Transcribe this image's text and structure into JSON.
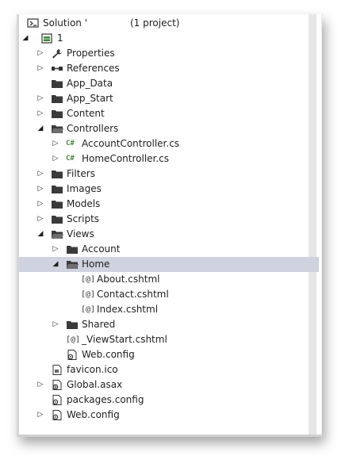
{
  "solution": {
    "label": "Solution '",
    "suffix": "(1 project)"
  },
  "project": {
    "label": "1"
  },
  "tree": [
    {
      "label": "Properties",
      "icon": "wrench-icon",
      "arrow": "collapsed"
    },
    {
      "label": "References",
      "icon": "references-icon",
      "arrow": "collapsed"
    },
    {
      "label": "App_Data",
      "icon": "folder-icon",
      "arrow": "none"
    },
    {
      "label": "App_Start",
      "icon": "folder-icon",
      "arrow": "collapsed"
    },
    {
      "label": "Content",
      "icon": "folder-icon",
      "arrow": "collapsed"
    },
    {
      "label": "Controllers",
      "icon": "folder-open-icon",
      "arrow": "expanded"
    },
    {
      "label": "AccountController.cs",
      "icon": "csharp-file-icon",
      "arrow": "collapsed"
    },
    {
      "label": "HomeController.cs",
      "icon": "csharp-file-icon",
      "arrow": "collapsed"
    },
    {
      "label": "Filters",
      "icon": "folder-icon",
      "arrow": "collapsed"
    },
    {
      "label": "Images",
      "icon": "folder-icon",
      "arrow": "collapsed"
    },
    {
      "label": "Models",
      "icon": "folder-icon",
      "arrow": "collapsed"
    },
    {
      "label": "Scripts",
      "icon": "folder-icon",
      "arrow": "collapsed"
    },
    {
      "label": "Views",
      "icon": "folder-open-icon",
      "arrow": "expanded"
    },
    {
      "label": "Account",
      "icon": "folder-icon",
      "arrow": "collapsed"
    },
    {
      "label": "Home",
      "icon": "folder-open-icon",
      "arrow": "expanded",
      "selected": true
    },
    {
      "label": "About.cshtml",
      "icon": "cshtml-file-icon",
      "arrow": "none"
    },
    {
      "label": "Contact.cshtml",
      "icon": "cshtml-file-icon",
      "arrow": "none"
    },
    {
      "label": "Index.cshtml",
      "icon": "cshtml-file-icon",
      "arrow": "none"
    },
    {
      "label": "Shared",
      "icon": "folder-icon",
      "arrow": "collapsed"
    },
    {
      "label": "_ViewStart.cshtml",
      "icon": "cshtml-file-icon",
      "arrow": "none"
    },
    {
      "label": "Web.config",
      "icon": "config-file-icon",
      "arrow": "none"
    },
    {
      "label": "favicon.ico",
      "icon": "image-file-icon",
      "arrow": "none"
    },
    {
      "label": "Global.asax",
      "icon": "global-asax-icon",
      "arrow": "collapsed"
    },
    {
      "label": "packages.config",
      "icon": "config-file-icon",
      "arrow": "none"
    },
    {
      "label": "Web.config",
      "icon": "config-file-icon",
      "arrow": "collapsed"
    }
  ],
  "glyphs": {
    "collapsed": "▷",
    "expanded": "◢",
    "csharp": "C#",
    "cshtml": "[@]"
  },
  "colors": {
    "selection": "#cfd2df",
    "csharp": "#4a8a3c"
  }
}
